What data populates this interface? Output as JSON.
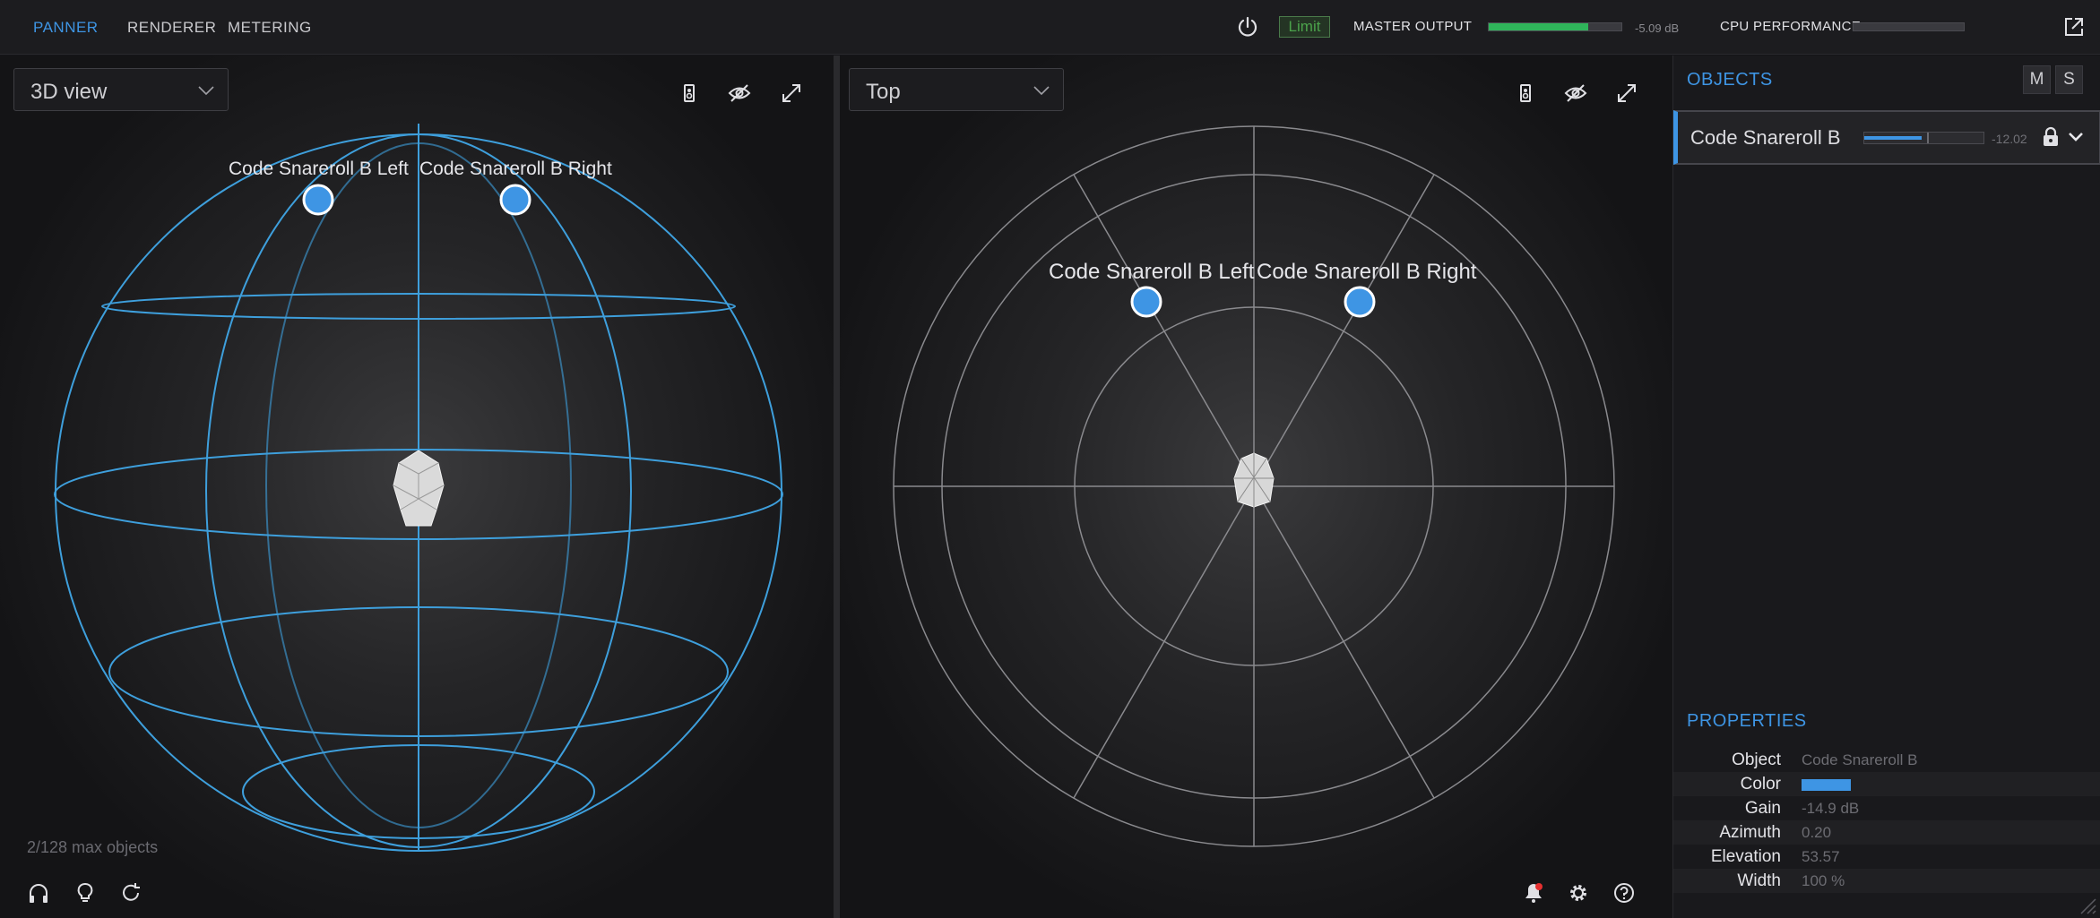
{
  "topbar": {
    "tabs": [
      {
        "label": "PANNER",
        "active": true
      },
      {
        "label": "RENDERER",
        "active": false
      },
      {
        "label": "METERING",
        "active": false
      }
    ],
    "limit_label": "Limit",
    "master_output_label": "MASTER OUTPUT",
    "master_output_level": 0.75,
    "master_output_db": "-5.09 dB",
    "cpu_label": "CPU PERFORMANCE",
    "cpu_level": 0.0
  },
  "left_view": {
    "mode": "3D view",
    "objects": [
      "Code Snareroll B Left",
      "Code Snareroll B Right"
    ],
    "max_objects": "2/128 max objects"
  },
  "mid_view": {
    "mode": "Top",
    "objects": [
      "Code Snareroll B Left",
      "Code Snareroll B Right"
    ]
  },
  "sidebar": {
    "objects_title": "OBJECTS",
    "mute_label": "M",
    "solo_label": "S",
    "object_row": {
      "name": "Code Snareroll B",
      "level_db": "-12.02",
      "level": 0.48
    },
    "properties_title": "PROPERTIES",
    "properties": [
      {
        "key": "Object",
        "value": "Code Snareroll B"
      },
      {
        "key": "Color",
        "value": ""
      },
      {
        "key": "Gain",
        "value": "-14.9 dB"
      },
      {
        "key": "Azimuth",
        "value": "0.20"
      },
      {
        "key": "Elevation",
        "value": "53.57"
      },
      {
        "key": "Width",
        "value": "100 %"
      }
    ]
  },
  "colors": {
    "accent": "#3e95e4",
    "meter_green": "#2fb45a",
    "limit_green": "#4ba24b",
    "notification_red": "#e53030"
  },
  "icons": [
    "power-icon",
    "popout-icon",
    "speaker-icon",
    "hide-icon",
    "expand-icon",
    "headphones-icon",
    "bulb-icon",
    "refresh-icon",
    "bell-icon",
    "gear-icon",
    "help-icon",
    "lock-icon",
    "chevron-down-icon"
  ]
}
